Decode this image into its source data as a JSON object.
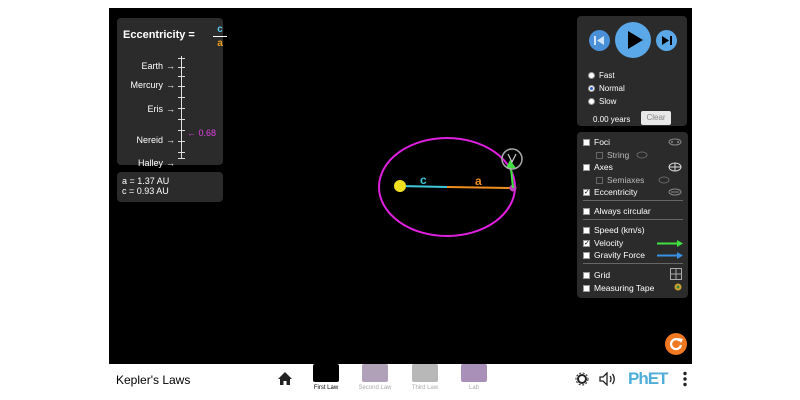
{
  "app": {
    "title": "Kepler's Laws"
  },
  "eccentricity_panel": {
    "title": "Eccentricity =",
    "numerator": "c",
    "denominator": "a",
    "bodies": [
      "Earth",
      "Mercury",
      "Eris",
      "Nereid",
      "Halley"
    ],
    "current_value": "0.68"
  },
  "orbit_info": {
    "a_line": "a = 1.37 AU",
    "c_line": "c = 0.93 AU"
  },
  "orbit_labels": {
    "c": "c",
    "a": "a"
  },
  "time_controls": {
    "speeds": [
      "Fast",
      "Normal",
      "Slow"
    ],
    "selected_speed": "Normal",
    "elapsed": "0.00 years",
    "clear_label": "Clear"
  },
  "options": {
    "foci": "Foci",
    "string": "String",
    "axes": "Axes",
    "semiaxes": "Semiaxes",
    "eccentricity": "Eccentricity",
    "always_circular": "Always circular",
    "speed": "Speed (km/s)",
    "velocity": "Velocity",
    "gravity_force": "Gravity Force",
    "grid": "Grid",
    "measuring_tape": "Measuring Tape"
  },
  "checked": {
    "eccentricity": true,
    "velocity": true
  },
  "colors": {
    "orbit": "#e020e0",
    "sun": "#f0e020",
    "c_axis": "#40c8d8",
    "a_axis": "#f09020",
    "velocity": "#40e040",
    "gravity": "#3890e0",
    "accent": "#5aa8e8",
    "reset": "#f07820"
  },
  "nav": {
    "screens": [
      "First Law",
      "Second Law",
      "Third Law",
      "Lab"
    ],
    "active_screen": "First Law",
    "brand": "PhET"
  }
}
